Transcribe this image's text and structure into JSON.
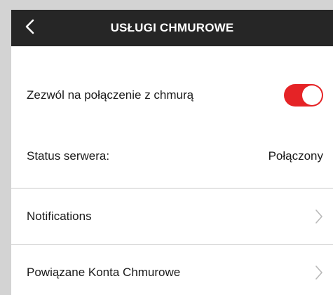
{
  "header": {
    "title": "USŁUGI CHMUROWE",
    "back_icon": "chevron-left-icon"
  },
  "settings": {
    "cloud_connection": {
      "label": "Zezwól na połączenie z chmurą",
      "enabled": true
    },
    "server_status": {
      "label": "Status serwera:",
      "value": "Połączony"
    },
    "notifications": {
      "label": "Notifications",
      "icon": "chevron-right-icon"
    },
    "linked_accounts": {
      "label": "Powiązane Konta Chmurowe",
      "icon": "chevron-right-icon"
    }
  },
  "colors": {
    "header_bg": "#262626",
    "toggle_on": "#e52326",
    "divider": "#c8c8c8",
    "chevron": "#b8b8b8"
  }
}
